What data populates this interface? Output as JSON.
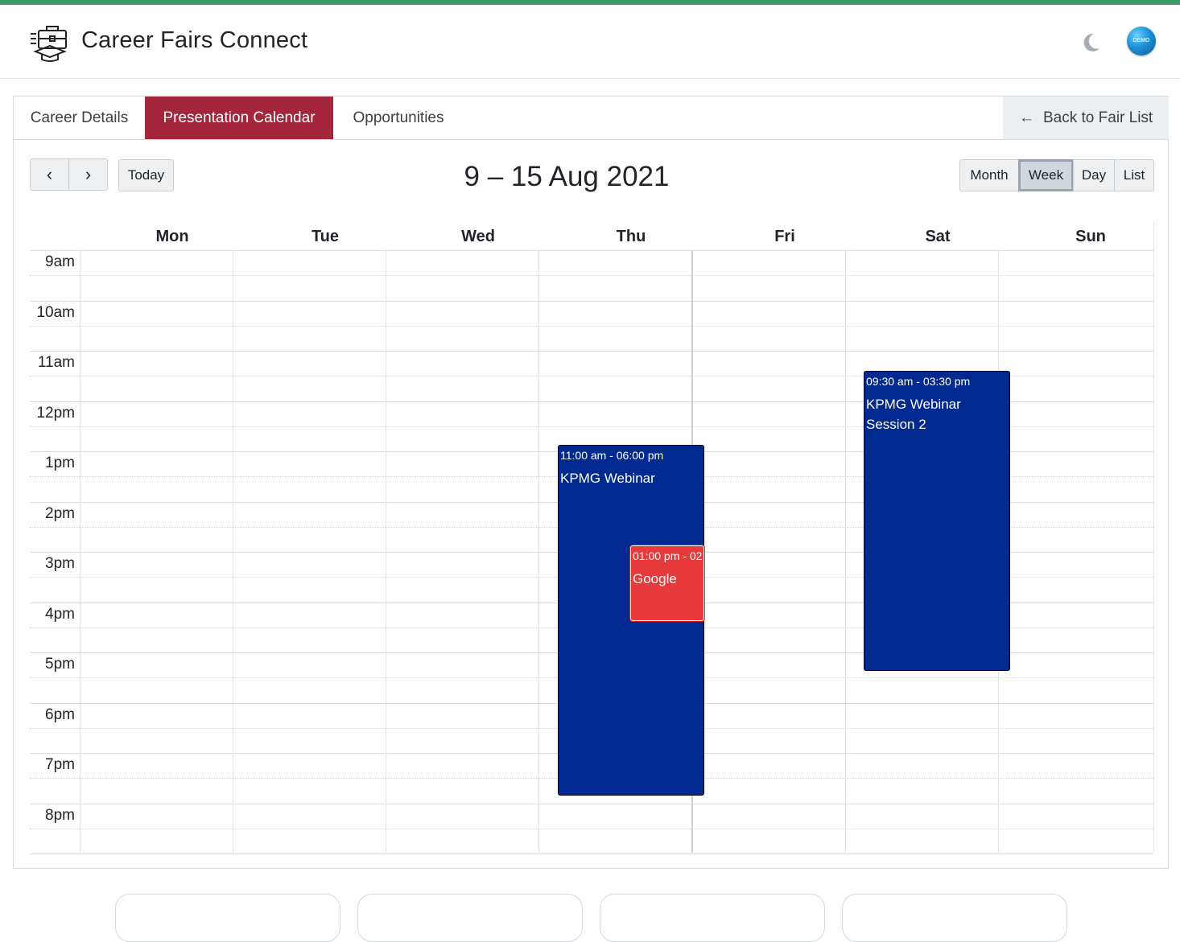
{
  "header": {
    "app_title": "Career Fairs Connect",
    "logo_icon": "briefcase-graduation-cap-icon",
    "theme_icon": "moon-icon",
    "avatar_text": "DEMO"
  },
  "tabs": [
    {
      "label": "Career Details",
      "active": false
    },
    {
      "label": "Presentation Calendar",
      "active": true
    },
    {
      "label": "Opportunities",
      "active": false
    }
  ],
  "back_button": {
    "label": "Back to Fair List",
    "icon": "arrow-left-icon"
  },
  "toolbar": {
    "prev_icon": "‹",
    "next_icon": "›",
    "today_label": "Today",
    "range_title": "9 – 15 Aug 2021",
    "views": [
      "Month",
      "Week",
      "Day",
      "List"
    ],
    "active_view": "Week"
  },
  "calendar": {
    "days": [
      "Mon",
      "Tue",
      "Wed",
      "Thu",
      "Fri",
      "Sat",
      "Sun"
    ],
    "today": "Thu",
    "hours": [
      "9am",
      "10am",
      "11am",
      "12pm",
      "1pm",
      "2pm",
      "3pm",
      "4pm",
      "5pm",
      "6pm",
      "7pm",
      "8pm"
    ],
    "events": [
      {
        "day": "Thu",
        "time": "11:00 am - 06:00 pm",
        "title": "KPMG Webinar",
        "color": "#002a8f"
      },
      {
        "day": "Thu",
        "time": "01:00 pm - 02",
        "title": "Google",
        "color": "#e83a3a"
      },
      {
        "day": "Sat",
        "time": "09:30 am - 03:30 pm",
        "title": "KPMG Webinar Session 2",
        "color": "#002a8f"
      }
    ]
  },
  "colors": {
    "accent": "#a4263b",
    "top_bar": "#3a9b68",
    "event_blue": "#002a8f",
    "event_red": "#e83a3a"
  }
}
